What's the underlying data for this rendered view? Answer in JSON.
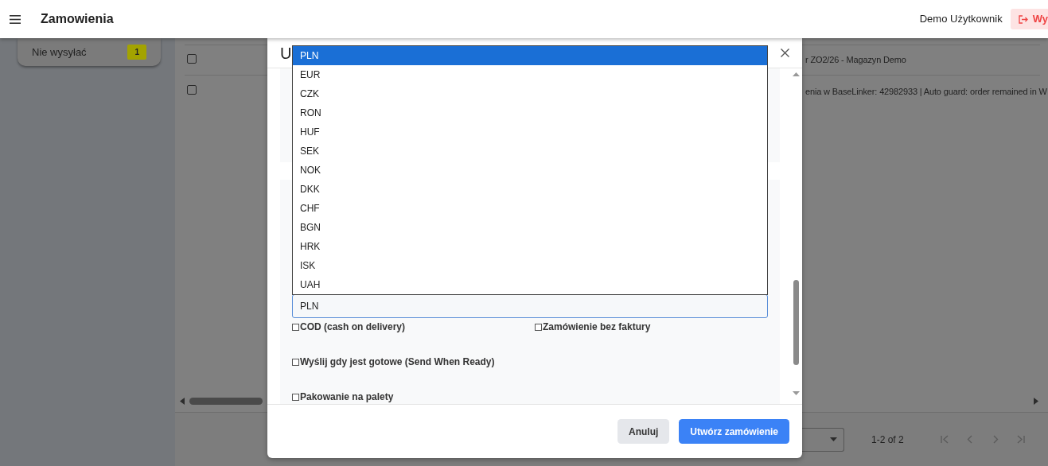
{
  "header": {
    "title": "Zamowienia",
    "user": "Demo Użytkownik",
    "logout_button": "Wy"
  },
  "sidebar": {
    "items": [
      {
        "label": "Nie wysyłać",
        "count": "1"
      }
    ]
  },
  "table": {
    "rows": [
      {
        "checked": false,
        "text": "r ZO2/26 - Magazyn Demo"
      },
      {
        "checked": false,
        "text": "enia w BaseLinker: 42982933 | Auto guard: order remained in W"
      }
    ]
  },
  "pagination": {
    "range": "1-2 of 2"
  },
  "modal": {
    "title": "U",
    "currency_field": {
      "value": "PLN",
      "expanded": true,
      "options": [
        {
          "label": "PLN",
          "selected": true
        },
        {
          "label": "EUR",
          "selected": false
        },
        {
          "label": "CZK",
          "selected": false
        },
        {
          "label": "RON",
          "selected": false
        },
        {
          "label": "HUF",
          "selected": false
        },
        {
          "label": "SEK",
          "selected": false
        },
        {
          "label": "NOK",
          "selected": false
        },
        {
          "label": "DKK",
          "selected": false
        },
        {
          "label": "CHF",
          "selected": false
        },
        {
          "label": "BGN",
          "selected": false
        },
        {
          "label": "HRK",
          "selected": false
        },
        {
          "label": "ISK",
          "selected": false
        },
        {
          "label": "UAH",
          "selected": false
        }
      ]
    },
    "checkbox_rows": [
      [
        {
          "label": "COD (cash on delivery)",
          "checked": false
        },
        {
          "label": "Zamówienie bez faktury",
          "checked": false
        }
      ],
      [
        {
          "label": "Wyślij gdy jest gotowe (Send When Ready)",
          "checked": false
        }
      ],
      [
        {
          "label": "Pakowanie na palety",
          "checked": false
        }
      ]
    ],
    "buttons": [
      {
        "label": "Anuluj",
        "kind": "secondary"
      },
      {
        "label": "Utwórz zamówienie",
        "kind": "primary"
      }
    ]
  }
}
